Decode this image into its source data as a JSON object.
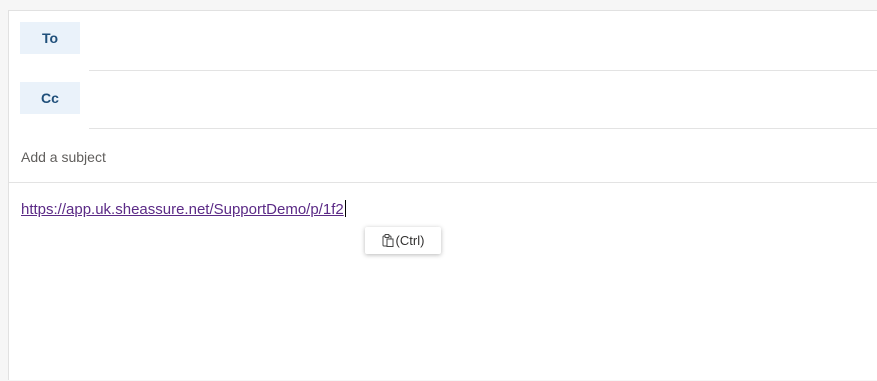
{
  "compose": {
    "to_label": "To",
    "cc_label": "Cc",
    "subject_placeholder": "Add a subject",
    "body_link": "https://app.uk.sheassure.net/SupportDemo/p/1f2",
    "paste_options": {
      "icon": "clipboard-icon",
      "label": "(Ctrl)"
    }
  },
  "colors": {
    "recipient_button_bg": "#eaf2fa",
    "recipient_button_text": "#1f4f7a",
    "link_color": "#5b2a86"
  }
}
